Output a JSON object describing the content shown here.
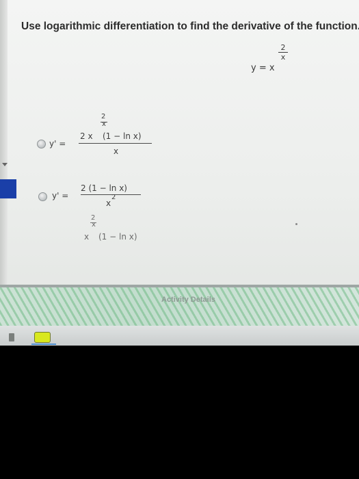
{
  "question": {
    "prompt": "Use logarithmic differentiation to find the derivative of the function."
  },
  "given_function": {
    "lhs": "y = x",
    "exponent_numerator": "2",
    "exponent_denominator": "x"
  },
  "options": [
    {
      "lhs": "y' =",
      "power_numerator": "2",
      "power_denominator": "x",
      "numerator": "2 x",
      "numerator_tail": "(1 − ln x)",
      "denominator": "x",
      "selected": false
    },
    {
      "lhs": "y' =",
      "numerator": "2 (1 − ln x)",
      "denominator": "x",
      "denominator_power": "2",
      "selected": false
    },
    {
      "power_numerator": "2",
      "power_denominator": "x",
      "numerator": "x",
      "numerator_tail": "(1 − ln x)",
      "selected": false
    }
  ],
  "banner": {
    "label": "Activity Details"
  },
  "icons": {
    "taskbar_app": "app-icon",
    "taskbar_left": "file-icon"
  }
}
